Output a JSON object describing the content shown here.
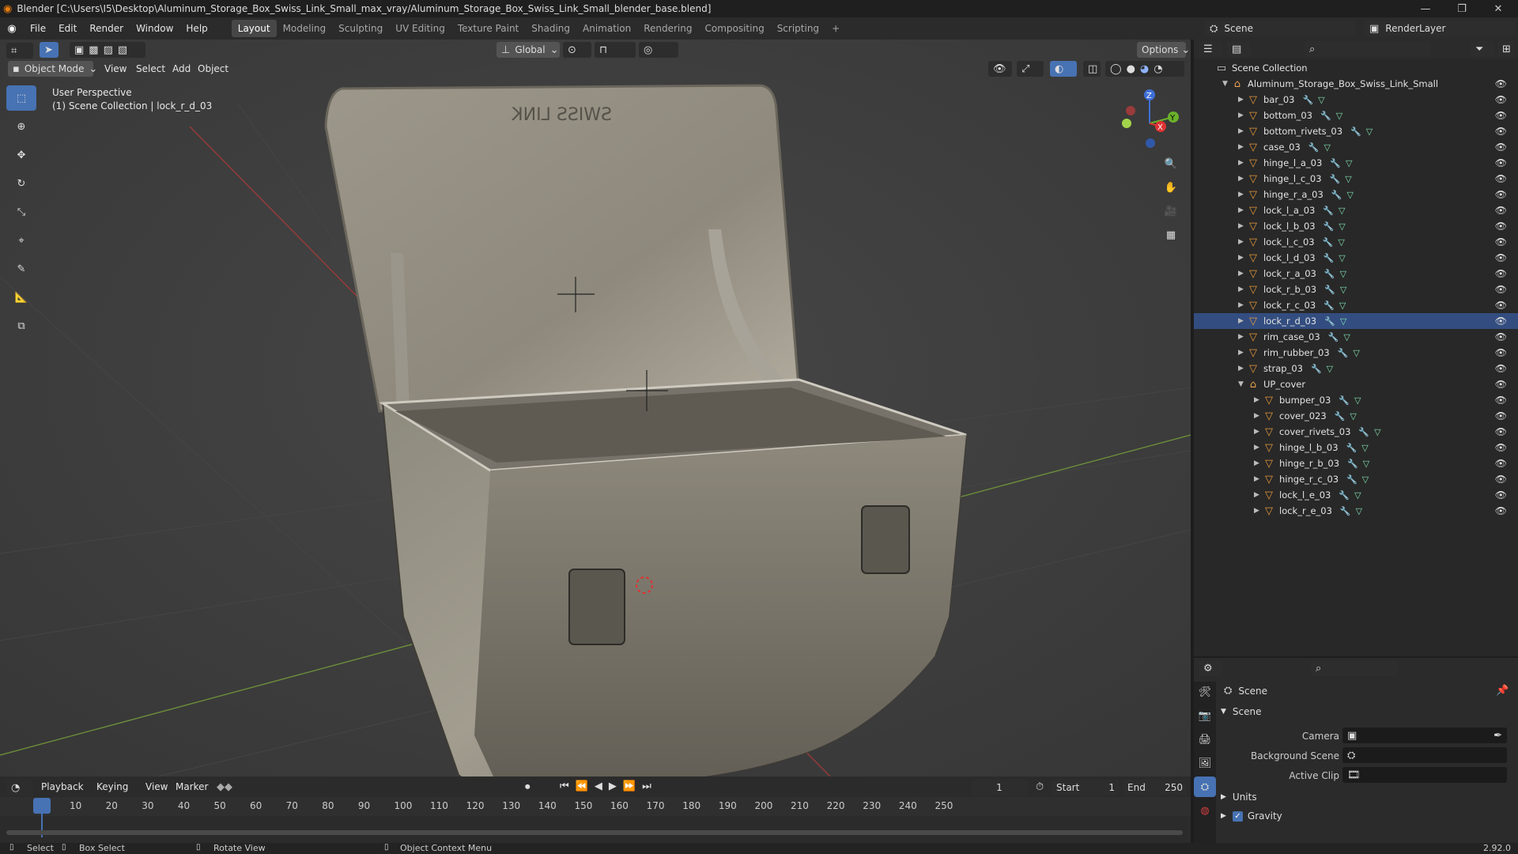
{
  "window": {
    "title": "Blender [C:\\Users\\I5\\Desktop\\Aluminum_Storage_Box_Swiss_Link_Small_max_vray/Aluminum_Storage_Box_Swiss_Link_Small_blender_base.blend]",
    "minimize": "—",
    "maximize": "❐",
    "close": "✕"
  },
  "menu": [
    "File",
    "Edit",
    "Render",
    "Window",
    "Help"
  ],
  "workspaces": [
    "Layout",
    "Modeling",
    "Sculpting",
    "UV Editing",
    "Texture Paint",
    "Shading",
    "Animation",
    "Rendering",
    "Compositing",
    "Scripting"
  ],
  "workspace_add": "+",
  "scene_selector": {
    "value": "Scene"
  },
  "renderlayer_selector": {
    "value": "RenderLayer"
  },
  "viewport": {
    "mode": "Object Mode",
    "menus": [
      "View",
      "Select",
      "Add",
      "Object"
    ],
    "orientation": "Global",
    "options": "Options",
    "overlay_title": "User Perspective",
    "overlay_subtitle": "(1) Scene Collection | lock_r_d_03",
    "lid_logo": "SWISS LINK",
    "gizmo": {
      "x": "X",
      "y": "Y",
      "z": "Z"
    }
  },
  "outliner": {
    "root": "Scene Collection",
    "collection": "Aluminum_Storage_Box_Swiss_Link_Small",
    "objects": [
      "bar_03",
      "bottom_03",
      "bottom_rivets_03",
      "case_03",
      "hinge_l_a_03",
      "hinge_l_c_03",
      "hinge_r_a_03",
      "lock_l_a_03",
      "lock_l_b_03",
      "lock_l_c_03",
      "lock_l_d_03",
      "lock_r_a_03",
      "lock_r_b_03",
      "lock_r_c_03",
      "lock_r_d_03",
      "rim_case_03",
      "rim_rubber_03",
      "strap_03"
    ],
    "group": "UP_cover",
    "group_objects": [
      "bumper_03",
      "cover_023",
      "cover_rivets_03",
      "hinge_l_b_03",
      "hinge_r_b_03",
      "hinge_r_c_03",
      "lock_l_e_03",
      "lock_r_e_03"
    ]
  },
  "properties": {
    "breadcrumb": "Scene",
    "panel": "Scene",
    "camera_label": "Camera",
    "background_label": "Background Scene",
    "clip_label": "Active Clip",
    "units": "Units",
    "gravity": "Gravity"
  },
  "timeline": {
    "menus": [
      "Playback",
      "Keying",
      "View",
      "Marker"
    ],
    "current_frame": "1",
    "start_label": "Start",
    "start_value": "1",
    "end_label": "End",
    "end_value": "250",
    "ticks": [
      "1",
      "10",
      "20",
      "30",
      "40",
      "50",
      "60",
      "70",
      "80",
      "90",
      "100",
      "110",
      "120",
      "130",
      "140",
      "150",
      "160",
      "170",
      "180",
      "190",
      "200",
      "210",
      "220",
      "230",
      "240",
      "250"
    ]
  },
  "statusbar": {
    "select": "Select",
    "box_select": "Box Select",
    "rotate": "Rotate View",
    "context": "Object Context Menu",
    "version": "2.92.0"
  }
}
